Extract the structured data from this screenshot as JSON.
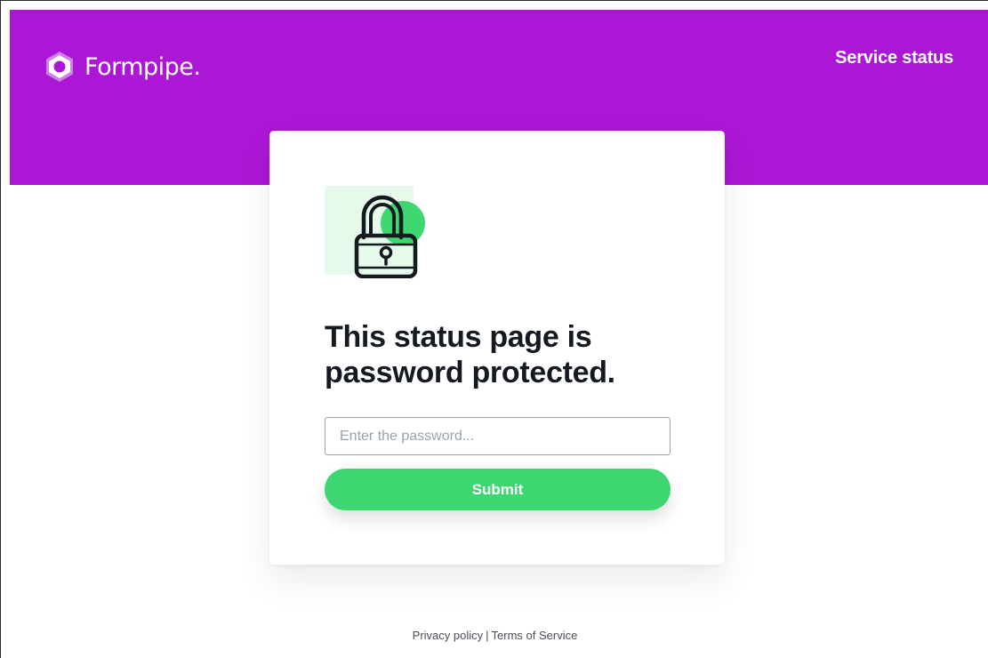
{
  "colors": {
    "brand": "#ab17d5",
    "accent": "#3dd670",
    "lock_bg": "#e6faec",
    "text_dark": "#151a21"
  },
  "header": {
    "logo_text": "Formpipe.",
    "logo_icon": "hexagon-ring-icon",
    "service_status_link": "Service status"
  },
  "card": {
    "illustration_icon": "padlock-icon",
    "title_line1": "This status page is",
    "title_line2": "password protected.",
    "password_placeholder": "Enter the password...",
    "submit_label": "Submit"
  },
  "footer": {
    "privacy_link": "Privacy policy",
    "separator": "|",
    "terms_link": "Terms of Service"
  }
}
